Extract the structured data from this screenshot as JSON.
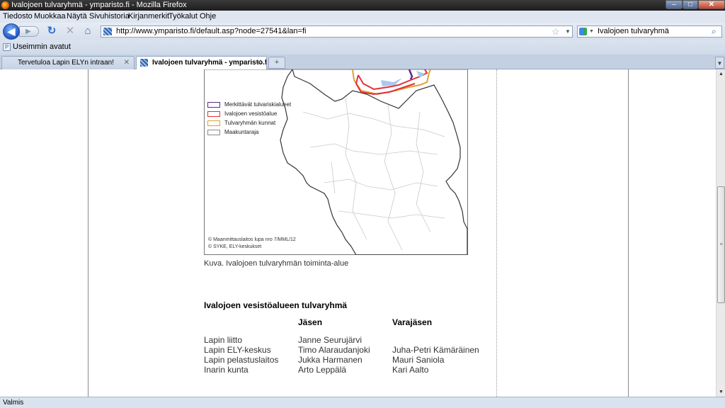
{
  "window": {
    "title": "Ivalojoen tulvaryhmä - ymparisto.fi - Mozilla Firefox",
    "minimize": "–",
    "maximize": "□",
    "close": "✕"
  },
  "menu": [
    "Tiedosto",
    "Muokkaa",
    "Näytä",
    "Sivuhistoria",
    "Kirjanmerkit",
    "Työkalut",
    "Ohje"
  ],
  "toolbar": {
    "back": "◀",
    "forward": "▶",
    "reload_icon": "reload-icon",
    "stop_icon": "stop-icon",
    "home_icon": "home-icon",
    "url": "http://www.ymparisto.fi/default.asp?node=27541&lan=fi",
    "bookmark_star": "☆",
    "search_query": "Ivalojoen tulvaryhmä"
  },
  "bookmarks": {
    "most_visited": "Useimmin avatut"
  },
  "tabs": [
    {
      "label": "Tervetuloa Lapin ELYn intraan!",
      "active": false
    },
    {
      "label": "Ivalojoen tulvaryhmä - ymparisto.fi",
      "active": true
    }
  ],
  "map": {
    "legend": [
      {
        "label": "Merkittävät tulvariskialueet",
        "color": "#5b2a86"
      },
      {
        "label": "Ivalojoen vesistöalue",
        "color": "#e0303a"
      },
      {
        "label": "Tulvaryhmän kunnat",
        "color": "#e0a030"
      },
      {
        "label": "Maakuntaraja",
        "color": "#8a8a8a"
      }
    ],
    "credits": [
      "© Maanmittauslaitos lupa nro 7/MML/12",
      "© SYKE, ELY-keskukset"
    ]
  },
  "content": {
    "caption": "Kuva. Ivalojoen tulvaryhmän toiminta-alue",
    "group_title": "Ivalojoen vesistöalueen tulvaryhmä",
    "col_member": "Jäsen",
    "col_deputy": "Varajäsen",
    "rows": [
      {
        "org": "Lapin liitto",
        "member": "Janne Seurujärvi",
        "deputy": ""
      },
      {
        "org": "Lapin ELY-keskus",
        "member": "Timo Alaraudanjoki",
        "deputy": "Juha-Petri Kämäräinen"
      },
      {
        "org": "Lapin pelastuslaitos",
        "member": "Jukka Harmanen",
        "deputy": "Mauri Saniola"
      },
      {
        "org": "Inarin kunta",
        "member": "Arto Leppälä",
        "deputy": "Kari Aalto"
      }
    ]
  },
  "status": "Valmis",
  "colors": {
    "accent": "#1e56c7",
    "status_bar": "#d9e3ef"
  }
}
